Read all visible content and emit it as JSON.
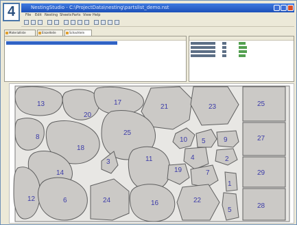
{
  "step_number": "4",
  "window": {
    "title": "NestingStudio - C:\\ProjectData\\nesting\\partslist_demo.nst"
  },
  "menu": [
    "File",
    "Edit",
    "Nesting",
    "Sheets",
    "Parts",
    "View",
    "Help"
  ],
  "toolbar_icons": [
    "new-icon",
    "open-icon",
    "save-icon",
    "undo-icon",
    "redo-icon",
    "nest-icon",
    "zoom-in-icon",
    "zoom-out-icon",
    "fit-icon",
    "run-icon",
    "stop-icon",
    "settings-icon",
    "help-icon"
  ],
  "tabs": [
    {
      "label": "Materialliste"
    },
    {
      "label": "Einzelteile"
    },
    {
      "label": "Schachteln",
      "active": true
    }
  ],
  "nest_parts": [
    {
      "label": "13"
    },
    {
      "label": "20"
    },
    {
      "label": "17"
    },
    {
      "label": "21"
    },
    {
      "label": "23"
    },
    {
      "label": "25"
    },
    {
      "label": "8"
    },
    {
      "label": "18"
    },
    {
      "label": "25"
    },
    {
      "label": "10"
    },
    {
      "label": "5"
    },
    {
      "label": "9"
    },
    {
      "label": "27"
    },
    {
      "label": "3"
    },
    {
      "label": "11"
    },
    {
      "label": "4"
    },
    {
      "label": "2"
    },
    {
      "label": "14"
    },
    {
      "label": "19"
    },
    {
      "label": "7"
    },
    {
      "label": "29"
    },
    {
      "label": "1"
    },
    {
      "label": "12"
    },
    {
      "label": "6"
    },
    {
      "label": "24"
    },
    {
      "label": "16"
    },
    {
      "label": "22"
    },
    {
      "label": "5"
    },
    {
      "label": "28"
    }
  ]
}
